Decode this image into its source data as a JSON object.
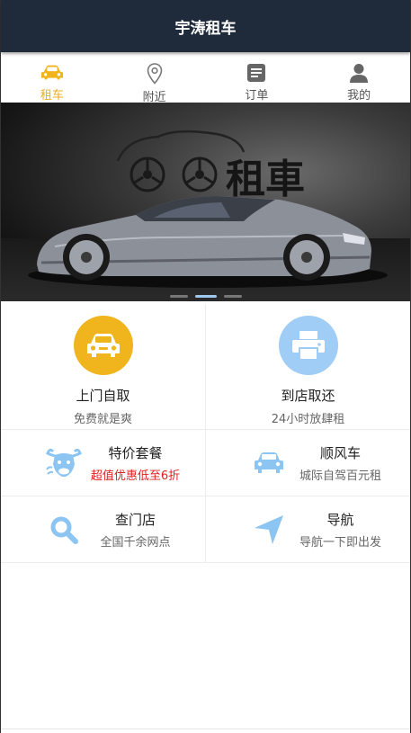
{
  "app": {
    "title": "宇涛租车"
  },
  "tabs": [
    {
      "label": "租车",
      "icon": "car-icon",
      "active": true
    },
    {
      "label": "附近",
      "icon": "location-pin-icon",
      "active": false
    },
    {
      "label": "订单",
      "icon": "order-list-icon",
      "active": false
    },
    {
      "label": "我的",
      "icon": "user-icon",
      "active": false
    }
  ],
  "banner": {
    "logo_text": "租車",
    "slide_count": 3,
    "active_slide": 2
  },
  "services": {
    "pickup": {
      "title": "上门自取",
      "subtitle": "免费就是爽",
      "icon": "car-front-icon",
      "color": "#f0b41c"
    },
    "store": {
      "title": "到店取还",
      "subtitle": "24小时放肆租",
      "icon": "printer-icon",
      "color": "#9fcdf5"
    },
    "special": {
      "title": "特价套餐",
      "subtitle": "超值优惠低至6折",
      "icon": "bull-icon"
    },
    "ride": {
      "title": "顺风车",
      "subtitle": "城际自驾百元租",
      "icon": "car-icon"
    },
    "find_store": {
      "title": "查门店",
      "subtitle": "全国千余网点",
      "icon": "search-icon"
    },
    "navigation": {
      "title": "导航",
      "subtitle": "导航一下即出发",
      "icon": "navigation-arrow-icon"
    }
  },
  "colors": {
    "header": "#1f2b3a",
    "accent": "#e9b020",
    "icon_blue": "#8cc4f2",
    "promo_red": "#e02020"
  }
}
